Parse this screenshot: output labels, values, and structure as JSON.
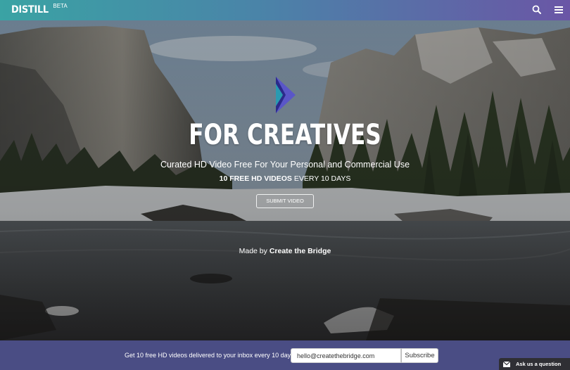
{
  "header": {
    "logo_text": "DISTILL",
    "logo_badge": "BETA",
    "search_icon": "search-icon",
    "menu_icon": "hamburger-menu-icon"
  },
  "hero": {
    "headline": "FOR CREATIVES",
    "subhead": "Curated HD Video Free For Your Personal and Commercial Use",
    "tagline_bold": "10 FREE HD VIDEOS",
    "tagline_rest": "EVERY 10 DAYS",
    "submit_label": "SUBMIT VIDEO",
    "madeby_prefix": "Made by",
    "madeby_link": "Create the Bridge"
  },
  "subscribe": {
    "text": "Get 10 free HD videos delivered to your inbox every 10 days.",
    "email_value": "hello@createthebridge.com",
    "button_label": "Subscribe"
  },
  "help": {
    "label": "Ask us a question",
    "icon": "mail-icon"
  },
  "colors": {
    "header_start": "#3aa3a4",
    "header_end": "#6a56a6",
    "subscribe_bar": "#4a4d84",
    "brand_mark_dark": "#2b2a8a",
    "brand_mark_light": "#5a56c8"
  }
}
